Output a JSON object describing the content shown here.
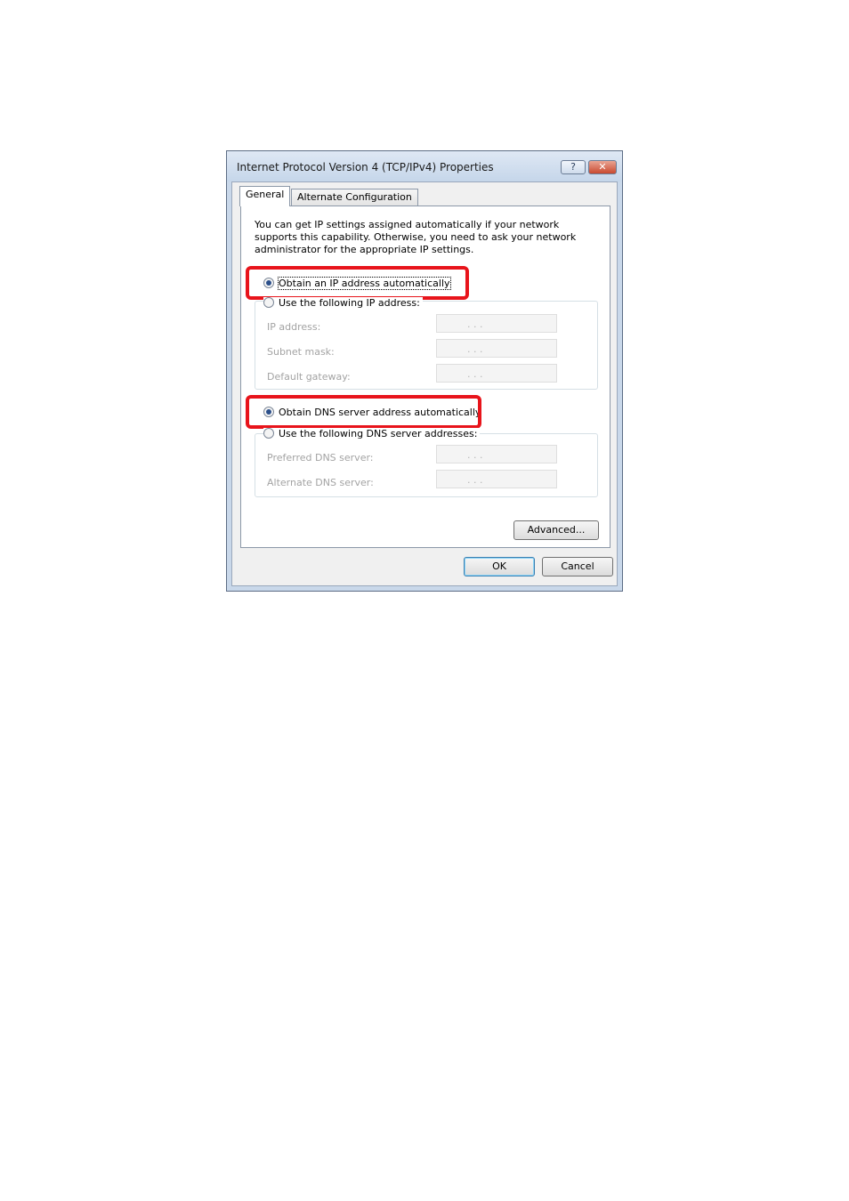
{
  "dialog": {
    "title": "Internet Protocol Version 4 (TCP/IPv4) Properties",
    "help_icon": "?",
    "close_icon": "✕"
  },
  "tabs": [
    {
      "label": "General",
      "active": true
    },
    {
      "label": "Alternate Configuration",
      "active": false
    }
  ],
  "general": {
    "description": "You can get IP settings assigned automatically if your network supports this capability. Otherwise, you need to ask your network administrator for the appropriate IP settings.",
    "ip_auto_label": "Obtain an IP address automatically",
    "ip_auto_selected": true,
    "ip_manual_label": "Use the following IP address:",
    "ip_fields": [
      {
        "label": "IP address:",
        "value": ". . ."
      },
      {
        "label": "Subnet mask:",
        "value": ". . ."
      },
      {
        "label": "Default gateway:",
        "value": ". . ."
      }
    ],
    "dns_auto_label": "Obtain DNS server address automatically",
    "dns_auto_selected": true,
    "dns_manual_label": "Use the following DNS server addresses:",
    "dns_fields": [
      {
        "label": "Preferred DNS server:",
        "value": ". . ."
      },
      {
        "label": "Alternate DNS server:",
        "value": ". . ."
      }
    ],
    "advanced_label": "Advanced..."
  },
  "footer": {
    "ok_label": "OK",
    "cancel_label": "Cancel"
  },
  "colors": {
    "highlight": "#e8141b",
    "title_bar": "#c9d8ea"
  }
}
